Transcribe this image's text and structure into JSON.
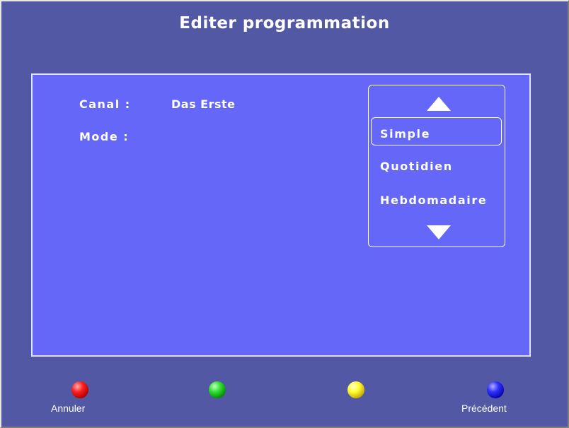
{
  "title": "Editer programmation",
  "form": {
    "canal_label": "Canal :",
    "canal_value": "Das Erste",
    "mode_label": "Mode :"
  },
  "mode_list": {
    "options": [
      "Simple",
      "Quotidien",
      "Hebdomadaire"
    ],
    "selected": "Simple"
  },
  "footer": {
    "buttons": [
      {
        "color": "red",
        "hex": "#ff2020",
        "label": "Annuler"
      },
      {
        "color": "green",
        "hex": "#30e030",
        "label": ""
      },
      {
        "color": "yellow",
        "hex": "#ffff30",
        "label": ""
      },
      {
        "color": "blue",
        "hex": "#3030ff",
        "label": "Précédent"
      }
    ]
  },
  "colors": {
    "background": "#5258a4",
    "panel": "#6467f8",
    "text": "#ffffff"
  }
}
